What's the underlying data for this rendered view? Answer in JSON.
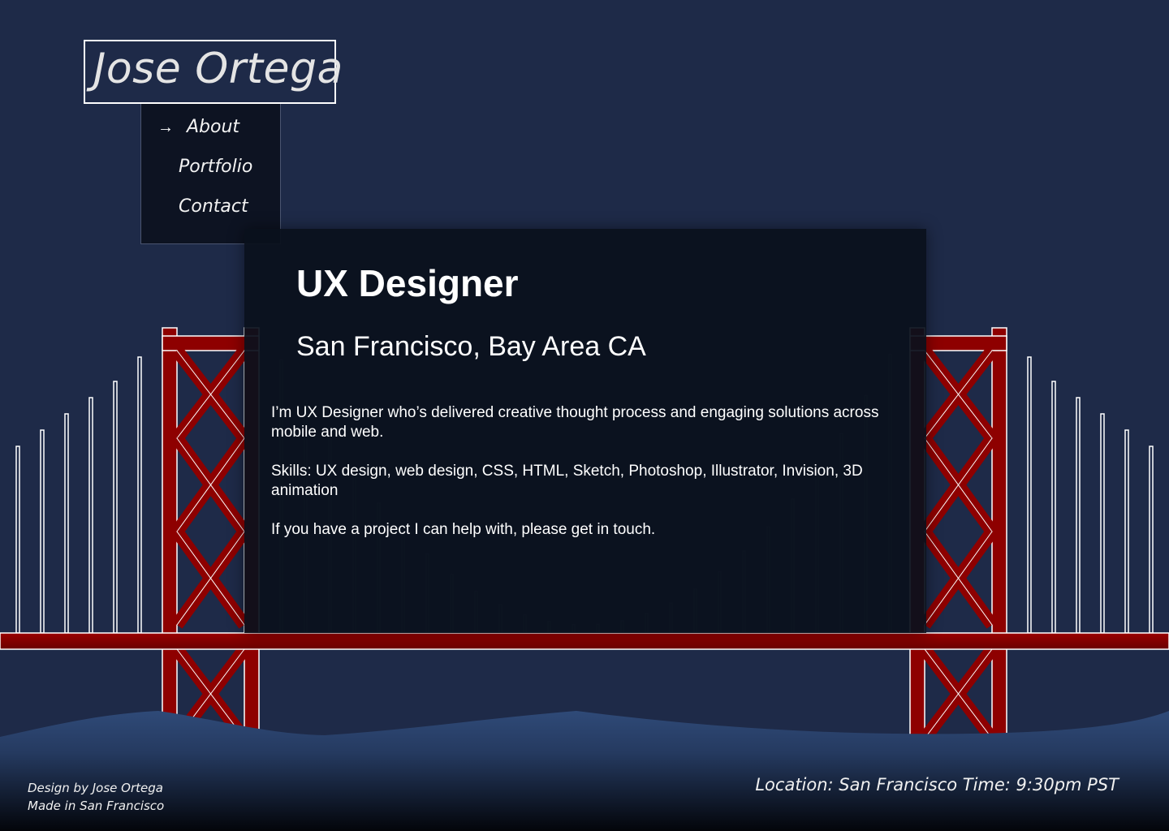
{
  "header": {
    "logo": "Jose Ortega"
  },
  "nav": {
    "items": [
      {
        "label": "About",
        "active": true
      },
      {
        "label": "Portfolio",
        "active": false
      },
      {
        "label": "Contact",
        "active": false
      }
    ],
    "active_icon": "arrow-right-icon"
  },
  "card": {
    "title": "UX Designer",
    "subtitle": "San Francisco, Bay Area CA",
    "paragraphs": [
      "I’m UX Designer who’s delivered creative thought process and engaging solutions across mobile and web.",
      "Skills: UX design, web design, CSS, HTML, Sketch, Photoshop, Illustrator, Invision, 3D animation",
      "If you have a project I can help with, please get in touch."
    ]
  },
  "footer": {
    "credit_line1": "Design by Jose Ortega",
    "credit_line2": "Made in San Francisco",
    "location": "Location: San Francisco Time: 9:30pm PST"
  },
  "colors": {
    "background": "#1e2a48",
    "bridge_red": "#8e0000",
    "card_bg": "#0a101c",
    "text": "#ffffff",
    "hills": "#2c4470"
  }
}
